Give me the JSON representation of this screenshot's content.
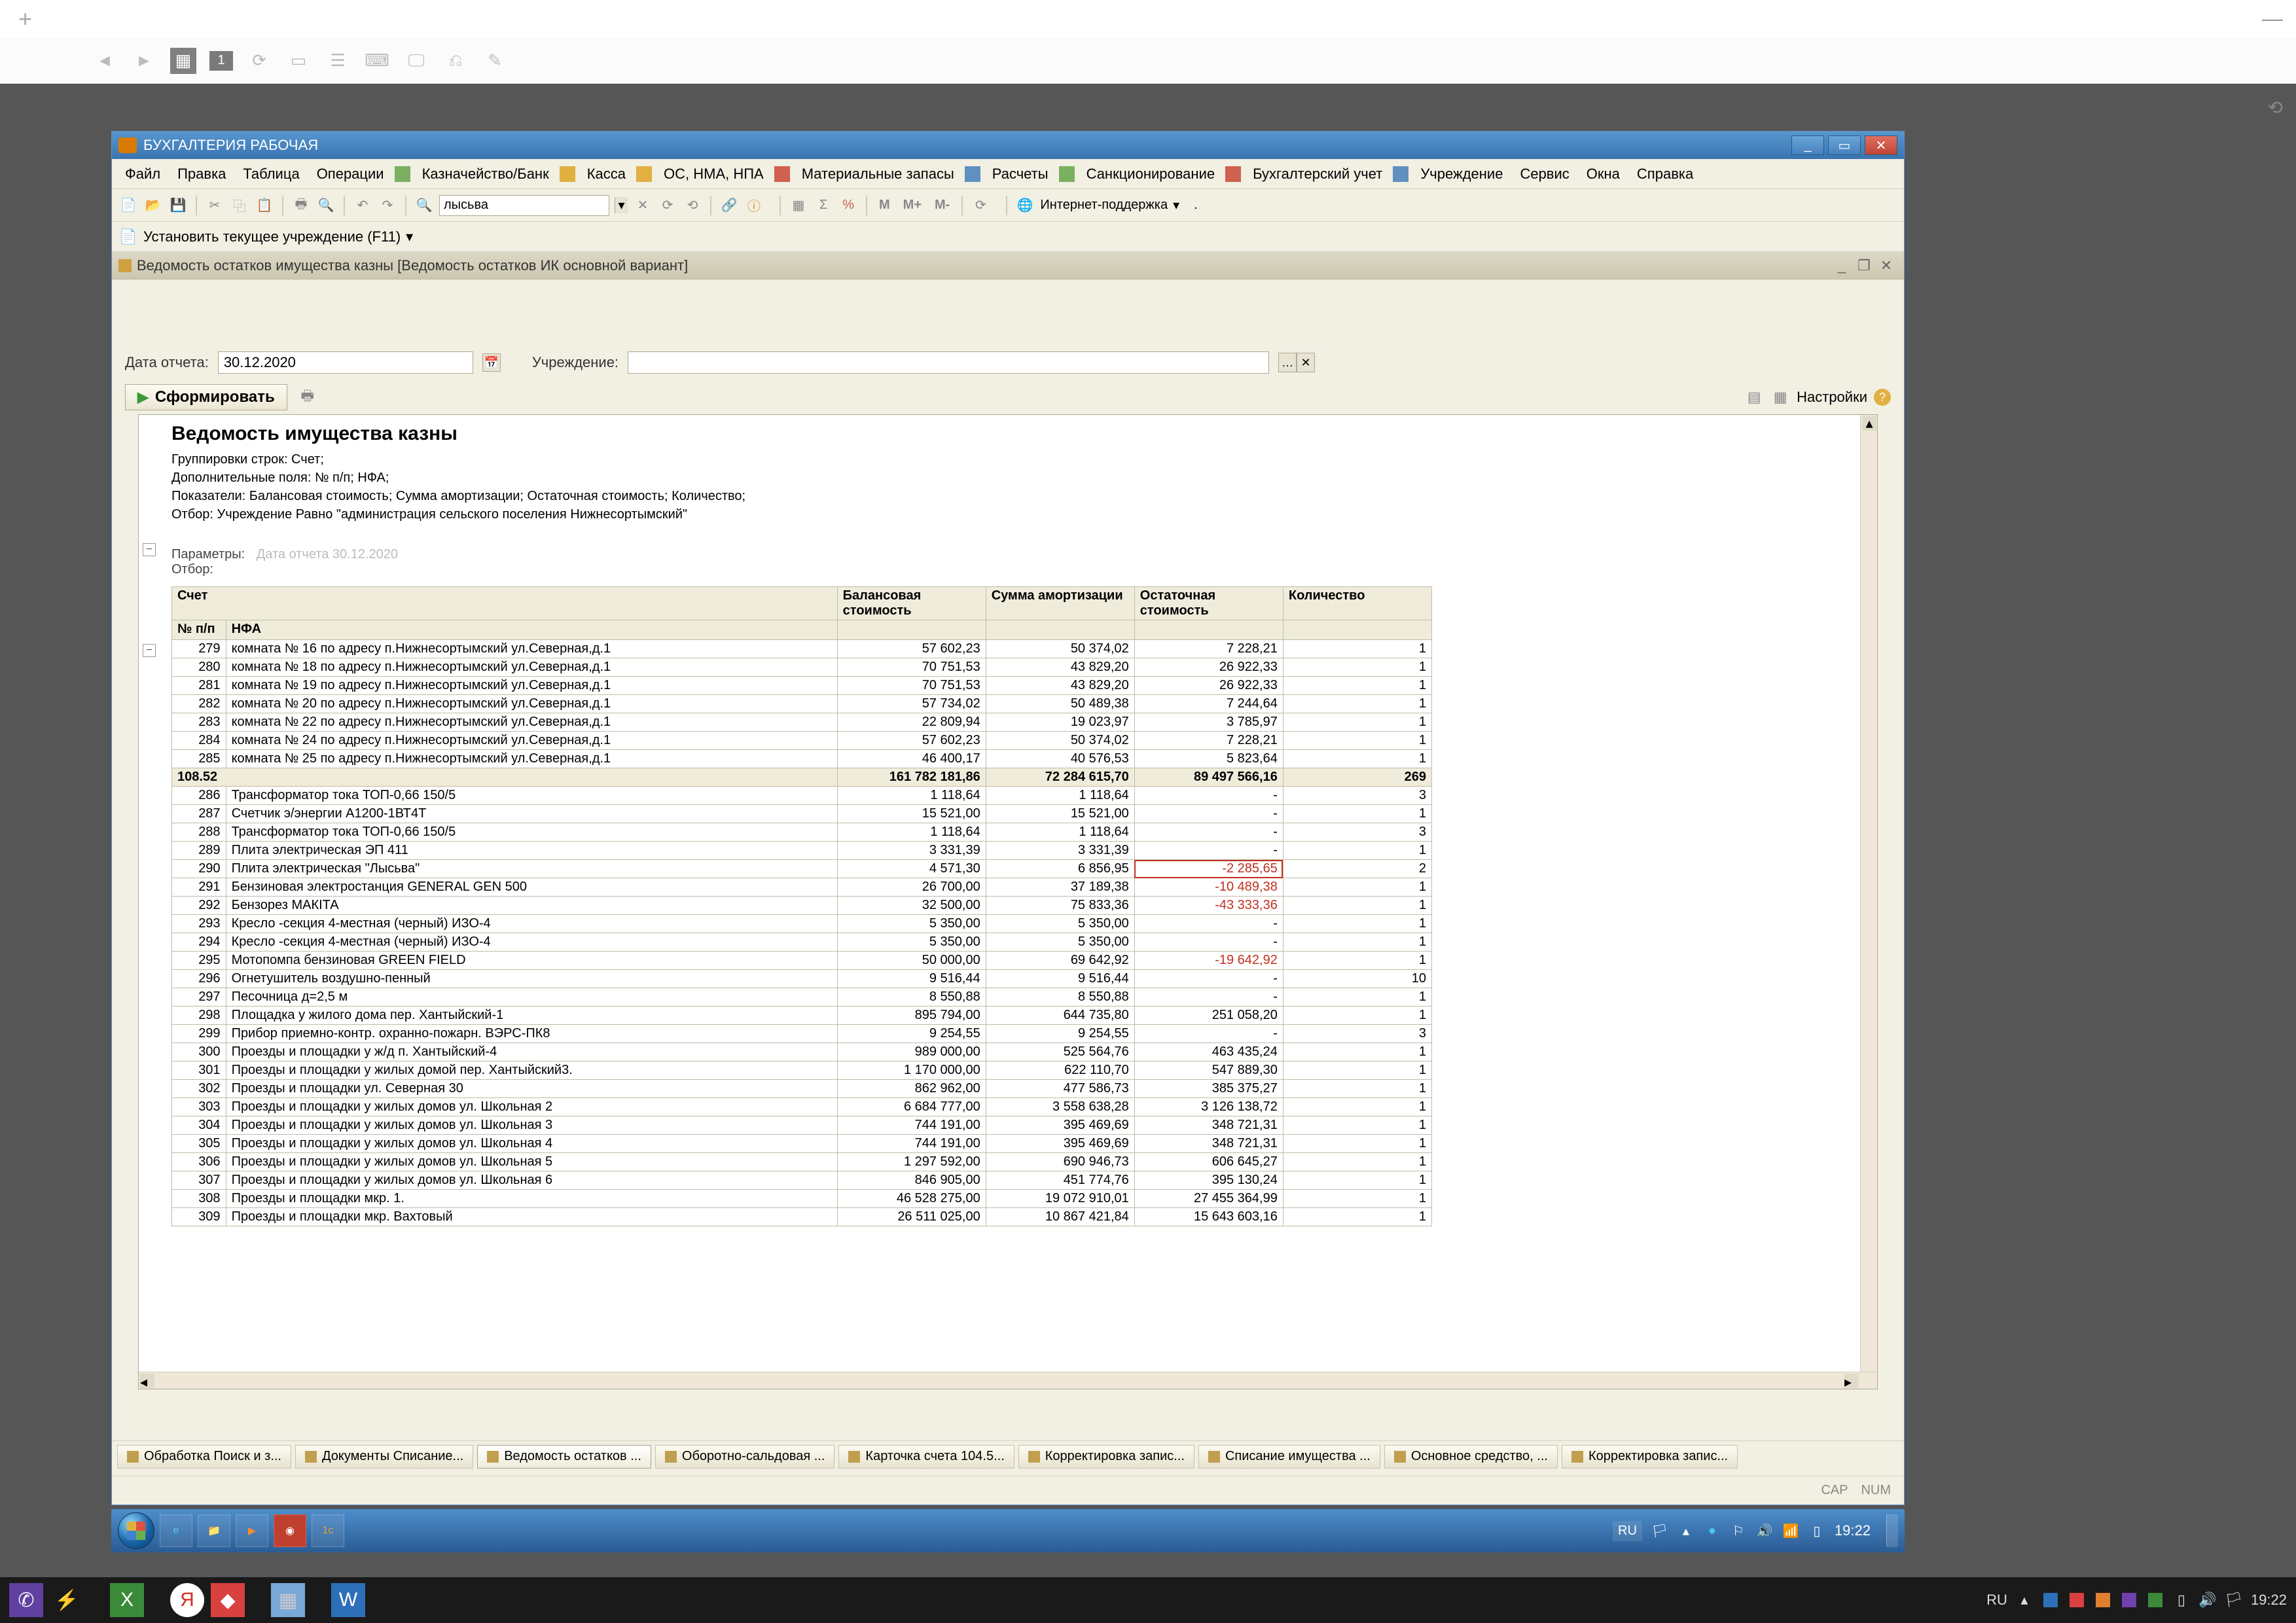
{
  "outer": {
    "tab_num": "1",
    "lang": "RU",
    "clock": "19:22"
  },
  "app": {
    "title": "БУХГАЛТЕРИЯ РАБОЧАЯ",
    "menu": [
      "Файл",
      "Правка",
      "Таблица",
      "Операции",
      "Казначейство/Банк",
      "Касса",
      "ОС, НМА, НПА",
      "Материальные запасы",
      "Расчеты",
      "Санкционирование",
      "Бухгалтерский учет",
      "Учреждение",
      "Сервис",
      "Окна",
      "Справка"
    ],
    "toolbar_search_value": "лысьва",
    "toolbar_m_labels": [
      "M",
      "M+",
      "M-"
    ],
    "internet_support": "Интернет-поддержка",
    "set_org": "Установить текущее учреждение (F11)",
    "sub_title": "Ведомость остатков имущества казны [Ведомость остатков ИК основной вариант]",
    "form": {
      "date_label": "Дата отчета:",
      "date_value": "30.12.2020",
      "org_label": "Учреждение:",
      "org_value": "",
      "run_label": "Сформировать",
      "settings_label": "Настройки"
    },
    "report": {
      "title": "Ведомость имущества казны",
      "meta": [
        "Группировки строк: Счет;",
        "Дополнительные поля: № п/п; НФА;",
        "Показатели: Балансовая стоимость; Сумма амортизации; Остаточная стоимость; Количество;",
        "Отбор: Учреждение Равно \"администрация сельского поселения Нижнесортымский\""
      ],
      "params_label": "Параметры:",
      "params_value": "Дата отчета 30.12.2020",
      "filter_label": "Отбор:",
      "headers": {
        "acc": "Счет",
        "npp": "№ п/п",
        "nfa": "НФА",
        "bal": "Балансовая стоимость",
        "amort": "Сумма амортизации",
        "ost": "Остаточная стоимость",
        "qty": "Количество"
      },
      "rows": [
        {
          "n": "279",
          "nfa": "комната № 16  по адресу п.Нижнесортымский  ул.Северная,д.1",
          "bal": "57 602,23",
          "am": "50 374,02",
          "ost": "7 228,21",
          "qty": "1"
        },
        {
          "n": "280",
          "nfa": "комната № 18  по адресу п.Нижнесортымский  ул.Северная,д.1",
          "bal": "70 751,53",
          "am": "43 829,20",
          "ost": "26 922,33",
          "qty": "1"
        },
        {
          "n": "281",
          "nfa": "комната № 19  по адресу п.Нижнесортымский  ул.Северная,д.1",
          "bal": "70 751,53",
          "am": "43 829,20",
          "ost": "26 922,33",
          "qty": "1"
        },
        {
          "n": "282",
          "nfa": "комната № 20  по адресу п.Нижнесортымский  ул.Северная,д.1",
          "bal": "57 734,02",
          "am": "50 489,38",
          "ost": "7 244,64",
          "qty": "1"
        },
        {
          "n": "283",
          "nfa": "комната № 22  по адресу п.Нижнесортымский  ул.Северная,д.1",
          "bal": "22 809,94",
          "am": "19 023,97",
          "ost": "3 785,97",
          "qty": "1"
        },
        {
          "n": "284",
          "nfa": "комната № 24  по адресу п.Нижнесортымский  ул.Северная,д.1",
          "bal": "57 602,23",
          "am": "50 374,02",
          "ost": "7 228,21",
          "qty": "1"
        },
        {
          "n": "285",
          "nfa": "комната № 25  по адресу п.Нижнесортымский  ул.Северная,д.1",
          "bal": "46 400,17",
          "am": "40 576,53",
          "ost": "5 823,64",
          "qty": "1"
        }
      ],
      "subtotal": {
        "acc": "108.52",
        "bal": "161 782 181,86",
        "am": "72 284 615,70",
        "ost": "89 497 566,16",
        "qty": "269"
      },
      "rows2": [
        {
          "n": "286",
          "nfa": "Трансформатор тока ТОП-0,66 150/5",
          "bal": "1 118,64",
          "am": "1 118,64",
          "ost": "-",
          "qty": "3"
        },
        {
          "n": "287",
          "nfa": "Счетчик э/энергии А1200-1ВТ4Т",
          "bal": "15 521,00",
          "am": "15 521,00",
          "ost": "-",
          "qty": "1"
        },
        {
          "n": "288",
          "nfa": "Трансформатор тока ТОП-0,66 150/5",
          "bal": "1 118,64",
          "am": "1 118,64",
          "ost": "-",
          "qty": "3"
        },
        {
          "n": "289",
          "nfa": "Плита электрическая ЭП 411",
          "bal": "3 331,39",
          "am": "3 331,39",
          "ost": "-",
          "qty": "1"
        },
        {
          "n": "290",
          "nfa": "Плита электрическая \"Лысьва\"",
          "bal": "4 571,30",
          "am": "6 856,95",
          "ost": "-2 285,65",
          "qty": "2",
          "negbox": true
        },
        {
          "n": "291",
          "nfa": "Бензиновая электростанция GENERAL GEN 500",
          "bal": "26 700,00",
          "am": "37 189,38",
          "ost": "-10 489,38",
          "qty": "1",
          "neg": true
        },
        {
          "n": "292",
          "nfa": "Бензорез МАКIТА",
          "bal": "32 500,00",
          "am": "75 833,36",
          "ost": "-43 333,36",
          "qty": "1",
          "neg": true
        },
        {
          "n": "293",
          "nfa": "Кресло -секция 4-местная (черный) ИЗО-4",
          "bal": "5 350,00",
          "am": "5 350,00",
          "ost": "-",
          "qty": "1"
        },
        {
          "n": "294",
          "nfa": "Кресло -секция 4-местная (черный) ИЗО-4",
          "bal": "5 350,00",
          "am": "5 350,00",
          "ost": "-",
          "qty": "1"
        },
        {
          "n": "295",
          "nfa": "Мотопомпа бензиновая GREEN FIELD",
          "bal": "50 000,00",
          "am": "69 642,92",
          "ost": "-19 642,92",
          "qty": "1",
          "neg": true
        },
        {
          "n": "296",
          "nfa": "Огнетушитель воздушно-пенный",
          "bal": "9 516,44",
          "am": "9 516,44",
          "ost": "-",
          "qty": "10"
        },
        {
          "n": "297",
          "nfa": "Песочница д=2,5 м",
          "bal": "8 550,88",
          "am": "8 550,88",
          "ost": "-",
          "qty": "1"
        },
        {
          "n": "298",
          "nfa": "Площадка у жилого дома пер. Хантыйский-1",
          "bal": "895 794,00",
          "am": "644 735,80",
          "ost": "251 058,20",
          "qty": "1"
        },
        {
          "n": "299",
          "nfa": "Прибор приемно-контр. охранно-пожарн. ВЭРС-ПК8",
          "bal": "9 254,55",
          "am": "9 254,55",
          "ost": "-",
          "qty": "3"
        },
        {
          "n": "300",
          "nfa": "Проезды и площадки у  ж/д п. Хантыйский-4",
          "bal": "989 000,00",
          "am": "525 564,76",
          "ost": "463 435,24",
          "qty": "1"
        },
        {
          "n": "301",
          "nfa": "Проезды и площадки у  жилых домой  пер. Хантыйский3.",
          "bal": "1 170 000,00",
          "am": "622 110,70",
          "ost": "547 889,30",
          "qty": "1"
        },
        {
          "n": "302",
          "nfa": "Проезды и площадки  ул. Северная 30",
          "bal": "862 962,00",
          "am": "477 586,73",
          "ost": "385 375,27",
          "qty": "1"
        },
        {
          "n": "303",
          "nfa": "Проезды и площадки у жилых домов  ул. Школьная 2",
          "bal": "6 684 777,00",
          "am": "3 558 638,28",
          "ost": "3 126 138,72",
          "qty": "1"
        },
        {
          "n": "304",
          "nfa": "Проезды и площадки  у жилых домов  ул. Школьная 3",
          "bal": "744 191,00",
          "am": "395 469,69",
          "ost": "348 721,31",
          "qty": "1"
        },
        {
          "n": "305",
          "nfa": "Проезды и площадки  у жилых домов  ул. Школьная 4",
          "bal": "744 191,00",
          "am": "395 469,69",
          "ost": "348 721,31",
          "qty": "1"
        },
        {
          "n": "306",
          "nfa": "Проезды и площадки у жилых домов  ул. Школьная 5",
          "bal": "1 297 592,00",
          "am": "690 946,73",
          "ost": "606 645,27",
          "qty": "1"
        },
        {
          "n": "307",
          "nfa": "Проезды и площадки у жилых домов  ул. Школьная 6",
          "bal": "846 905,00",
          "am": "451 774,76",
          "ost": "395 130,24",
          "qty": "1"
        },
        {
          "n": "308",
          "nfa": "Проезды и площадки мкр. 1.",
          "bal": "46 528 275,00",
          "am": "19 072 910,01",
          "ost": "27 455 364,99",
          "qty": "1"
        },
        {
          "n": "309",
          "nfa": "Проезды и площадки мкр. Вахтовый",
          "bal": "26 511 025,00",
          "am": "10 867 421,84",
          "ost": "15 643 603,16",
          "qty": "1"
        }
      ]
    },
    "tabs": [
      "Обработка  Поиск и з...",
      "Документы Списание...",
      "Ведомость остатков ...",
      "Оборотно-сальдовая ...",
      "Карточка счета 104.5...",
      "Корректировка запис...",
      "Списание имущества ...",
      "Основное средство, ...",
      "Корректировка запис..."
    ],
    "status": {
      "cap": "CAP",
      "num": "NUM"
    }
  }
}
